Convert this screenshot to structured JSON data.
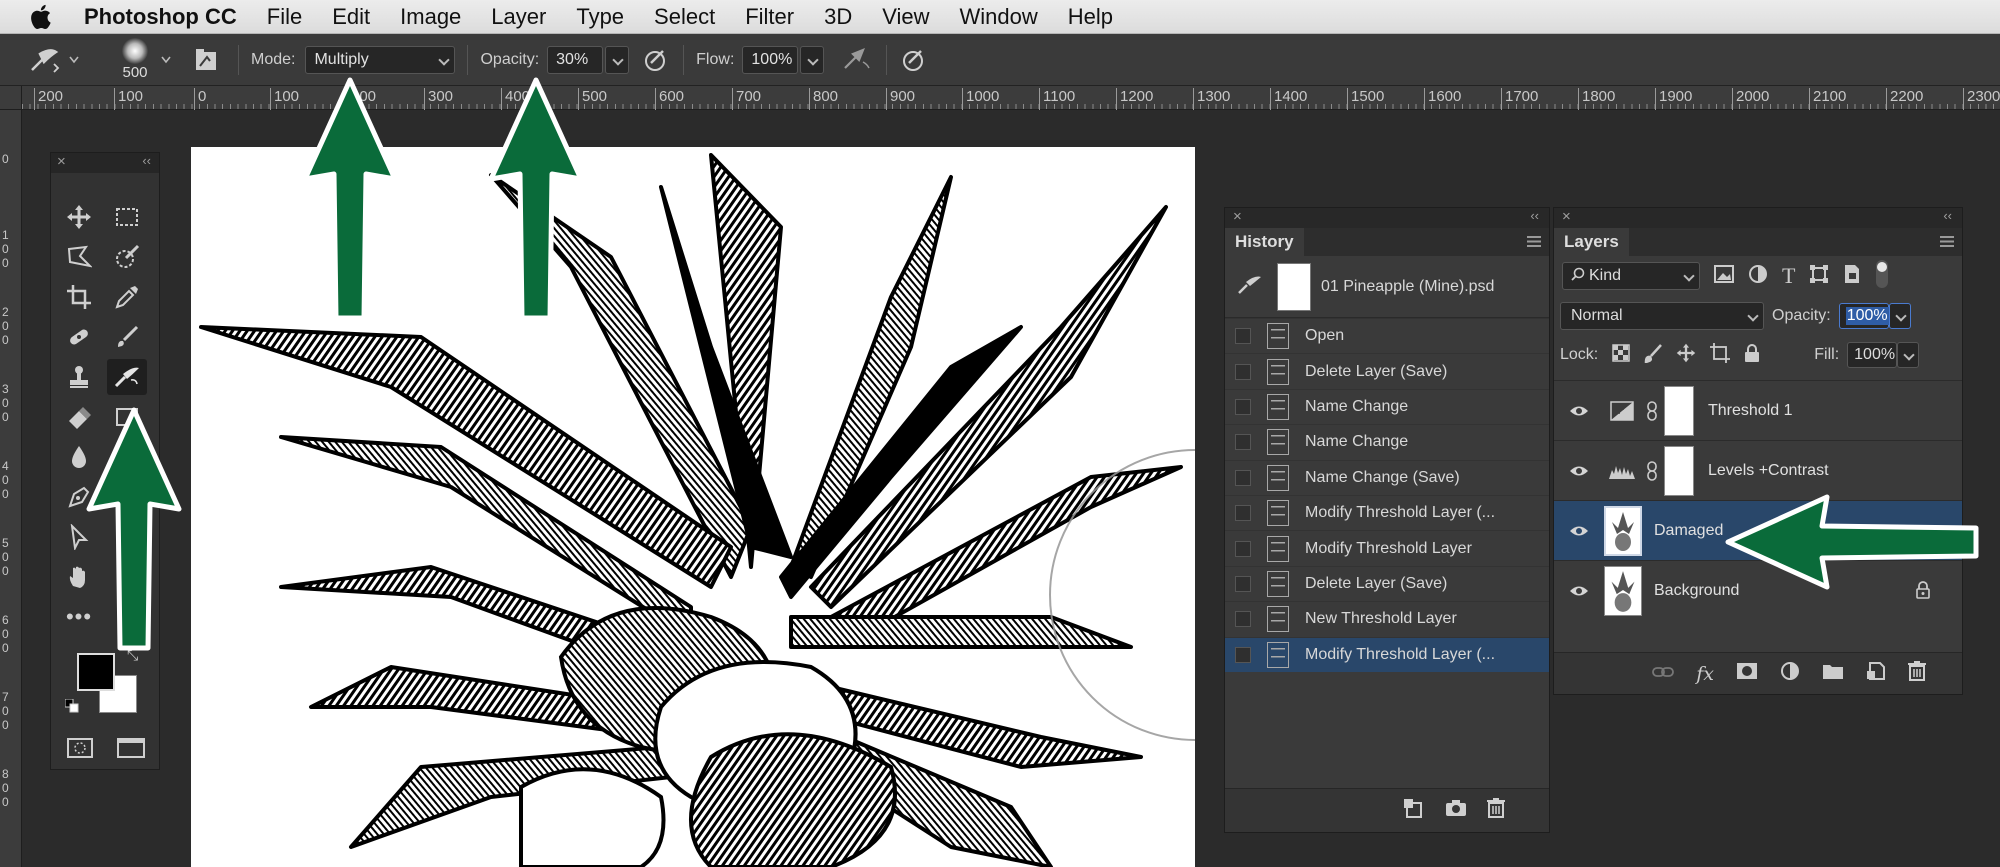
{
  "menubar": {
    "app_name": "Photoshop CC",
    "items": [
      "File",
      "Edit",
      "Image",
      "Layer",
      "Type",
      "Select",
      "Filter",
      "3D",
      "View",
      "Window",
      "Help"
    ]
  },
  "options_bar": {
    "brush_size": "500",
    "mode_label": "Mode:",
    "mode_value": "Multiply",
    "opacity_label": "Opacity:",
    "opacity_value": "30%",
    "flow_label": "Flow:",
    "flow_value": "100%"
  },
  "ruler": {
    "labels": [
      "200",
      "100",
      "0",
      "100",
      "200",
      "300",
      "400",
      "500",
      "600",
      "700",
      "800",
      "900",
      "1000",
      "1100",
      "1200",
      "1300",
      "1400",
      "1500",
      "1600",
      "1700",
      "1800",
      "1900",
      "2000",
      "2100",
      "2200",
      "2300"
    ],
    "vertical": [
      "0",
      "1\n0\n0",
      "2\n0\n0",
      "3\n0\n0",
      "4\n0\n0",
      "5\n0\n0",
      "6\n0\n0",
      "7\n0\n0",
      "8\n0\n0"
    ]
  },
  "history": {
    "tab": "History",
    "snapshot": "01 Pineapple (Mine).psd",
    "items": [
      "Open",
      "Delete Layer (Save)",
      "Name Change",
      "Name Change",
      "Name Change (Save)",
      "Modify Threshold Layer (...",
      "Modify Threshold Layer",
      "Delete Layer (Save)",
      "New Threshold Layer",
      "Modify Threshold Layer (..."
    ],
    "selected_index": 9
  },
  "layers": {
    "tab": "Layers",
    "kind": "Kind",
    "blend_mode": "Normal",
    "opacity_label": "Opacity:",
    "opacity_value": "100%",
    "lock_label": "Lock:",
    "fill_label": "Fill:",
    "fill_value": "100%",
    "items": [
      {
        "name": "Threshold 1"
      },
      {
        "name": "Levels +Contrast"
      },
      {
        "name": "Damaged"
      },
      {
        "name": "Background"
      }
    ],
    "selected_index": 2
  },
  "colors": {
    "accent_arrow": "#0a6b3a",
    "selection": "#29476a"
  }
}
